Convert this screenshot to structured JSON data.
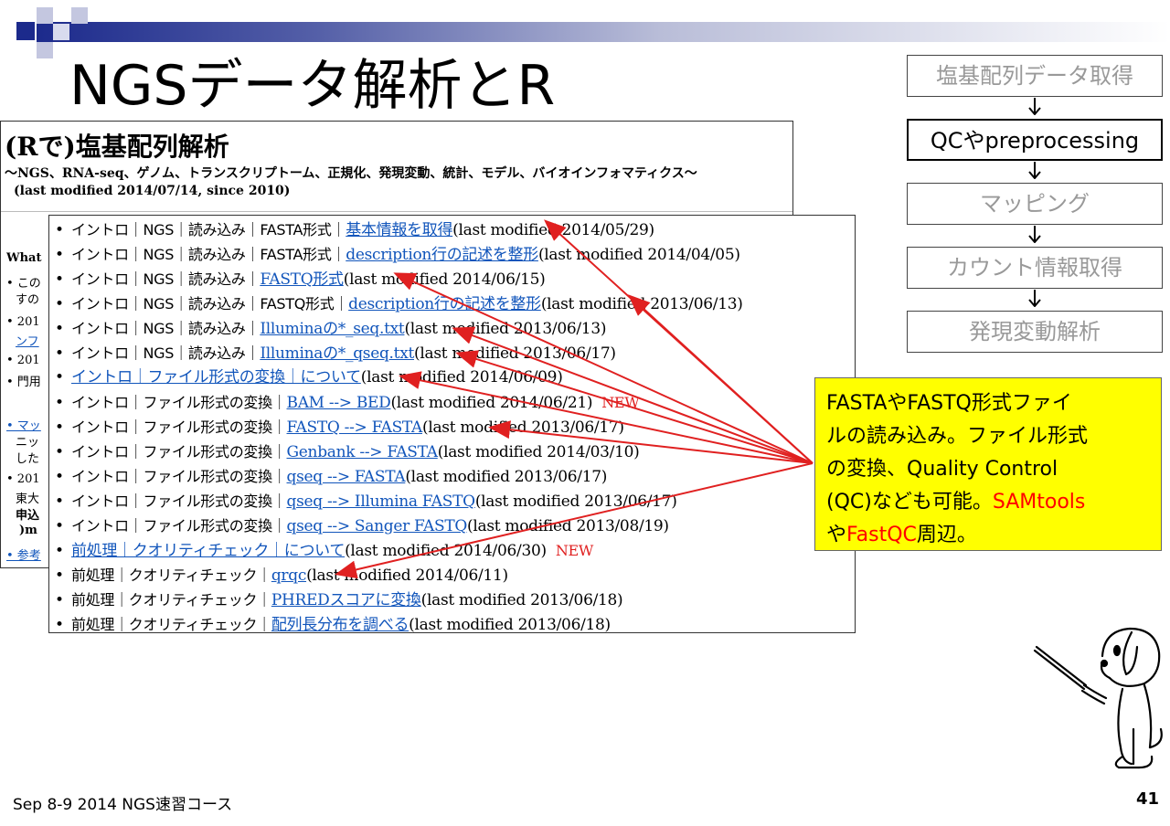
{
  "slide_title": "NGSデータ解析とR",
  "page": {
    "title": "(Rで)塩基配列解析",
    "subtitle": "〜NGS、RNA-seq、ゲノム、トランスクリプトーム、正規化、発現変動、統計、モデル、バイオインフォマティクス〜",
    "modified": "(last modified 2014/07/14, since 2010)",
    "left_fragments": [
      "What",
      "• この",
      "すの",
      "• 201",
      "ンフ",
      "• 201",
      "• 門用",
      "• マッ",
      "ニッ",
      "した",
      "• 201",
      "東大",
      "申込",
      ")m",
      "• 参考"
    ]
  },
  "list_rows": [
    {
      "pre": "イントロ｜NGS｜読み込み｜FASTA形式｜",
      "link": "基本情報を取得",
      "post": "(last modified 2014/05/29)",
      "new": ""
    },
    {
      "pre": "イントロ｜NGS｜読み込み｜FASTA形式｜",
      "link": "description行の記述を整形",
      "post": "(last modified 2014/04/05)",
      "new": ""
    },
    {
      "pre": "イントロ｜NGS｜読み込み｜",
      "link": "FASTQ形式",
      "post": "(last modified 2014/06/15)",
      "new": ""
    },
    {
      "pre": "イントロ｜NGS｜読み込み｜FASTQ形式｜",
      "link": "description行の記述を整形",
      "post": "(last modified 2013/06/13)",
      "new": ""
    },
    {
      "pre": "イントロ｜NGS｜読み込み｜",
      "link": "Illuminaの*_seq.txt",
      "post": "(last modified 2013/06/13)",
      "new": ""
    },
    {
      "pre": "イントロ｜NGS｜読み込み｜",
      "link": "Illuminaの*_qseq.txt",
      "post": "(last modified 2013/06/17)",
      "new": ""
    },
    {
      "pre": "",
      "link": "イントロ｜ファイル形式の変換｜について",
      "post": "(last modified 2014/06/09)",
      "new": ""
    },
    {
      "pre": "イントロ｜ファイル形式の変換｜",
      "link": "BAM --> BED",
      "post": "(last modified 2014/06/21)",
      "new": "NEW"
    },
    {
      "pre": "イントロ｜ファイル形式の変換｜",
      "link": "FASTQ --> FASTA",
      "post": "(last modified 2013/06/17)",
      "new": ""
    },
    {
      "pre": "イントロ｜ファイル形式の変換｜",
      "link": "Genbank --> FASTA",
      "post": "(last modified 2014/03/10)",
      "new": ""
    },
    {
      "pre": "イントロ｜ファイル形式の変換｜",
      "link": "qseq --> FASTA",
      "post": "(last modified 2013/06/17)",
      "new": ""
    },
    {
      "pre": "イントロ｜ファイル形式の変換｜",
      "link": "qseq --> Illumina FASTQ",
      "post": "(last modified 2013/06/17)",
      "new": ""
    },
    {
      "pre": "イントロ｜ファイル形式の変換｜",
      "link": "qseq --> Sanger FASTQ",
      "post": "(last modified 2013/08/19)",
      "new": ""
    },
    {
      "pre": "",
      "link": "前処理｜クオリティチェック｜について",
      "post": "(last modified 2014/06/30)",
      "new": "NEW"
    },
    {
      "pre": "前処理｜クオリティチェック｜",
      "link": "qrqc",
      "post": "(last modified 2014/06/11)",
      "new": ""
    },
    {
      "pre": "前処理｜クオリティチェック｜",
      "link": "PHREDスコアに変換",
      "post": "(last modified 2013/06/18)",
      "new": ""
    },
    {
      "pre": "前処理｜クオリティチェック｜",
      "link": "配列長分布を調べる",
      "post": "(last modified 2013/06/18)",
      "new": ""
    }
  ],
  "flow": [
    {
      "label": "塩基配列データ取得",
      "active": false
    },
    {
      "label": "QCやpreprocessing",
      "active": true
    },
    {
      "label": "マッピング",
      "active": false
    },
    {
      "label": "カウント情報取得",
      "active": false
    },
    {
      "label": "発現変動解析",
      "active": false
    }
  ],
  "callout": {
    "line1": "FASTAやFASTQ形式ファイ",
    "line2": "ルの読み込み。ファイル形式",
    "line3": "の変換、Quality Control",
    "line4a": "(QC)なども可能。",
    "line4b": "SAMtools",
    "line5a": "や",
    "line5b": "FastQC",
    "line5c": "周辺。"
  },
  "footer": {
    "left": "Sep 8-9 2014 NGS速習コース",
    "page": "41"
  },
  "colors": {
    "accent_red": "#e02020",
    "callout_bg": "#ffff00",
    "link": "#1155bb"
  }
}
